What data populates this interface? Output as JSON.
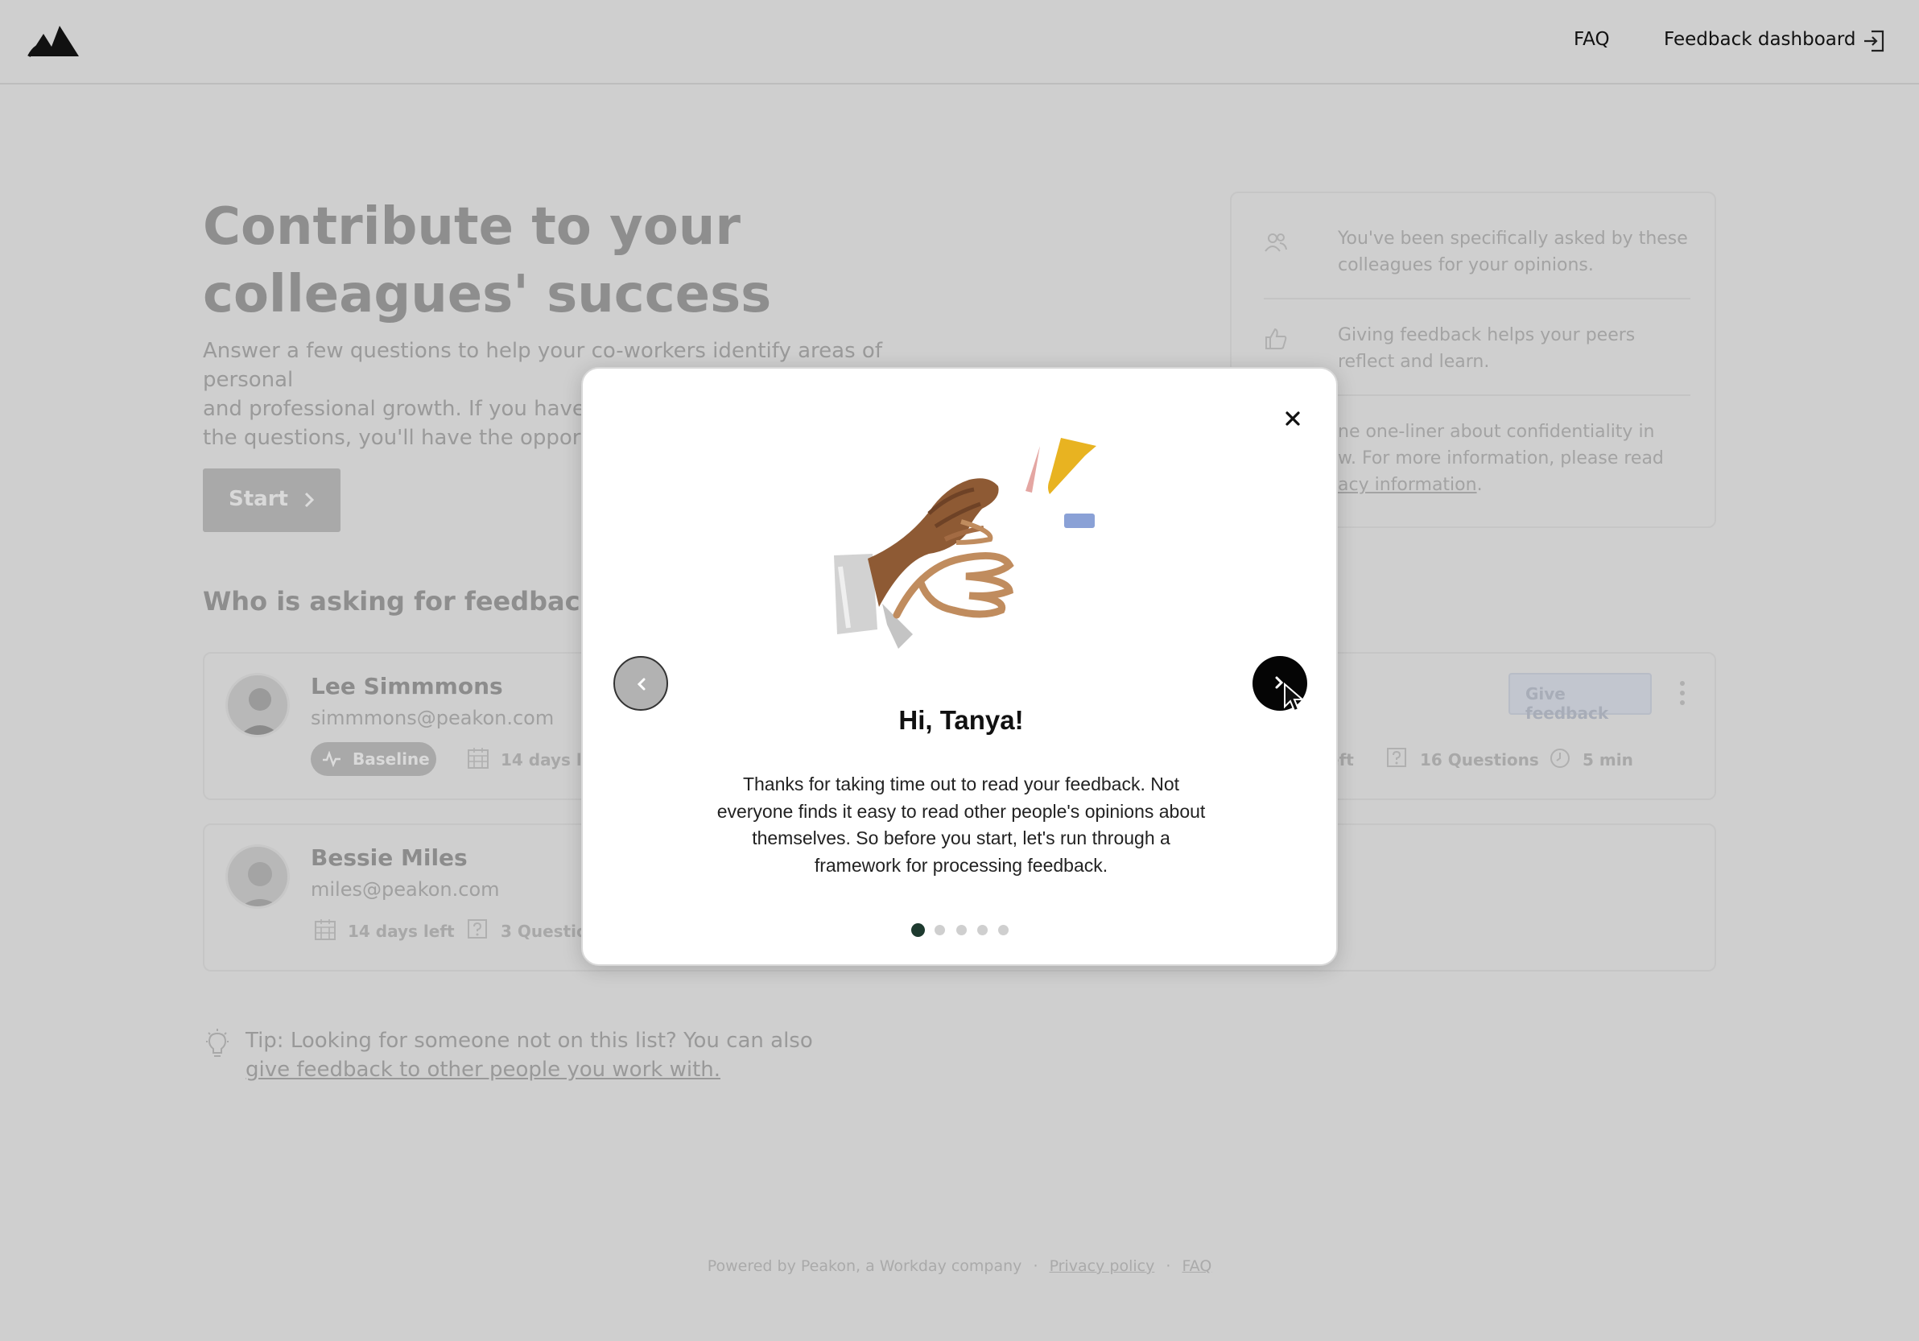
{
  "header": {
    "faq_label": "FAQ",
    "dashboard_label": "Feedback dashboard"
  },
  "hero": {
    "title": "Contribute to your colleagues' success",
    "subtitle_visible_line1": "Answer a few questions to help your co-workers identify areas of personal",
    "subtitle_visible_line2": "and professional growth. If you have fe",
    "subtitle_visible_line3": "the questions, you'll have the opportur",
    "start_label": "Start"
  },
  "who_section": {
    "title_visible": "Who is asking for feedback in"
  },
  "info_card": {
    "items": [
      {
        "icon": "people-icon",
        "text": "You've been specifically asked by these colleagues for your opinions."
      },
      {
        "icon": "thumbs-up-icon",
        "text": "Giving feedback helps your peers reflect and learn."
      },
      {
        "icon": "lock-icon",
        "text_visible_line1": "ne one-liner about confidentiality in",
        "text_visible_line2": "w. For more information, please read",
        "link_visible": "acy information",
        "suffix": "."
      }
    ]
  },
  "people": [
    {
      "name": "Lee Simmmons",
      "email": "simmmons@peakon.com",
      "badge": "Baseline",
      "days_left_visible": "14 days lef",
      "right_days_visible": "eft",
      "questions": "16 Questions",
      "duration": "5 min",
      "give_feedback_label": "Give feedback"
    },
    {
      "name": "Bessie Miles",
      "email": "miles@peakon.com",
      "days_left": "14 days left",
      "questions_visible": "3 Question"
    }
  ],
  "tip": {
    "text": "Tip: Looking for someone not on this list? You can also",
    "link": "give feedback to other people you work with."
  },
  "footer": {
    "powered": "Powered by Peakon, a Workday company",
    "separator": "·",
    "privacy": "Privacy policy",
    "faq": "FAQ"
  },
  "modal": {
    "title": "Hi, Tanya!",
    "body": "Thanks for taking time out to read your feedback. Not everyone finds it easy to read other people's opinions about themselves. So before you start, let's run through a framework for processing feedback.",
    "dots_total": 5,
    "active_dot": 1,
    "colors": {
      "active_dot": "#1e3a2f",
      "next_button": "#050505"
    }
  }
}
